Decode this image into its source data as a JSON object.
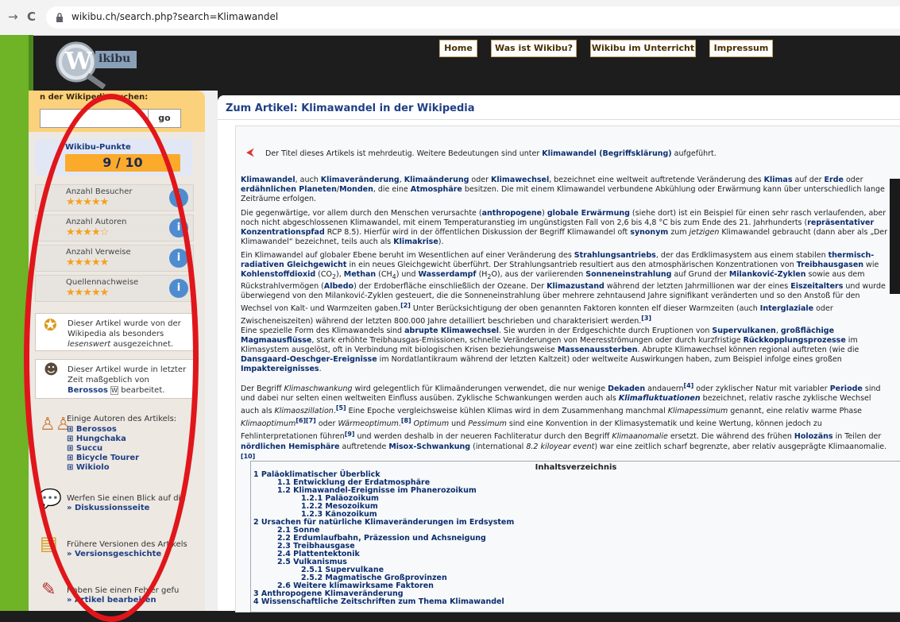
{
  "browser": {
    "back": "→",
    "reload": "C",
    "url": "wikibu.ch/search.php?search=Klimawandel"
  },
  "logo": {
    "text": "ikibu",
    "letter": "W"
  },
  "topnav": [
    "Home",
    "Was ist Wikibu?",
    "Wikibu im Unterricht",
    "Impressum"
  ],
  "sidebar": {
    "search_label": "n der Wikipedia suchen:",
    "search_value": "",
    "go": "go",
    "points_label": "Wikibu-Punkte",
    "points_value": "9 / 10",
    "points_fraction": 0.9,
    "stats": [
      {
        "label": "Anzahl Besucher",
        "stars": 5
      },
      {
        "label": "Anzahl Autoren",
        "stars": 4
      },
      {
        "label": "Anzahl Verweise",
        "stars": 5
      },
      {
        "label": "Quellennachweise",
        "stars": 5
      }
    ],
    "award_line1": "Dieser Artikel wurde von der",
    "award_line2": "Wikipedia als besonders",
    "award_line3_em": "lesenswert",
    "award_line3_rest": " ausgezeichnet.",
    "recent_line1": "Dieser Artikel wurde in letzter",
    "recent_line2": "Zeit maßgeblich von",
    "recent_author": "Berossos",
    "recent_rest": " bearbeitet.",
    "authors_label": "Einige Autoren des Artikels:",
    "authors": [
      "Berossos",
      "Hungchaka",
      "Succu",
      "Bicycle Tourer",
      "Wikiolo"
    ],
    "discussion_text": "Werfen Sie einen Blick auf die",
    "discussion_link": "» Diskussionsseite",
    "versions_text": "Frühere Versionen des Artikels",
    "versions_link": "» Versionsgeschichte",
    "error_text": "Haben Sie einen Fehler gefu",
    "error_link": "» Artikel bearbeiten"
  },
  "panel": {
    "title": "Zum Artikel: Klimawandel in der Wikipedia",
    "hatnote_pre": "Der Titel dieses Artikels ist mehrdeutig. Weitere Bedeutungen sind unter ",
    "hatnote_link": "Klimawandel (Begriffsklärung)",
    "hatnote_post": " aufgeführt."
  },
  "toc": {
    "title": "Inhaltsverzeichnis",
    "items": [
      {
        "text": "1 Paläoklimatischer Überblick",
        "level": 0
      },
      {
        "text": "1.1 Entwicklung der Erdatmosphäre",
        "level": 1
      },
      {
        "text": "1.2 Klimawandel-Ereignisse im Phanerozoikum",
        "level": 1
      },
      {
        "text": "1.2.1 Paläozoikum",
        "level": 2
      },
      {
        "text": "1.2.2 Mesozoikum",
        "level": 2
      },
      {
        "text": "1.2.3 Känozoikum",
        "level": 2
      },
      {
        "text": "2 Ursachen für natürliche Klimaveränderungen im Erdsystem",
        "level": 0
      },
      {
        "text": "2.1 Sonne",
        "level": 1
      },
      {
        "text": "2.2 Erdumlaufbahn, Präzession und Achsneigung",
        "level": 1
      },
      {
        "text": "2.3 Treibhausgase",
        "level": 1
      },
      {
        "text": "2.4 Plattentektonik",
        "level": 1
      },
      {
        "text": "2.5 Vulkanismus",
        "level": 1
      },
      {
        "text": "2.5.1 Supervulkane",
        "level": 2
      },
      {
        "text": "2.5.2 Magmatische Großprovinzen",
        "level": 2
      },
      {
        "text": "2.6 Weitere klimawirksame Faktoren",
        "level": 1
      },
      {
        "text": "3 Anthropogene Klimaveränderung",
        "level": 0
      },
      {
        "text": "4 Wissenschaftliche Zeitschriften zum Thema Klimawandel",
        "level": 0
      }
    ]
  },
  "colors": {
    "accent": "#fbaa2b",
    "link": "#0a2d6e",
    "annotation": "#e0161b"
  }
}
